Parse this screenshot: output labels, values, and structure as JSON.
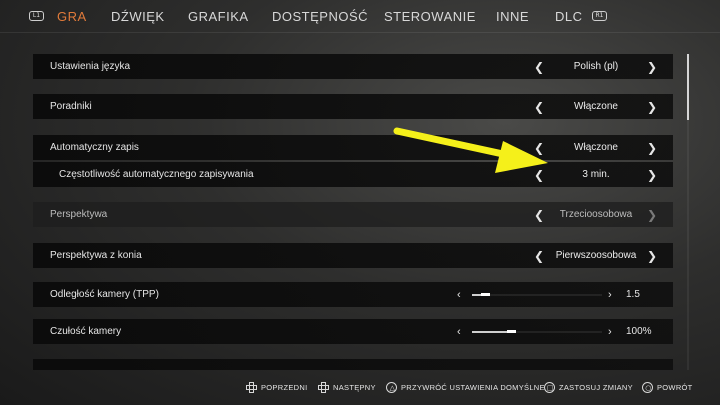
{
  "tabs": {
    "left_shoulder": "L1",
    "right_shoulder": "R1",
    "items": [
      "GRA",
      "DŹWIĘK",
      "GRAFIKA",
      "DOSTĘPNOŚĆ",
      "STEROWANIE",
      "INNE",
      "DLC"
    ]
  },
  "settings": [
    {
      "label": "Ustawienia języka",
      "value": "Polish (pl)"
    },
    {
      "label": "Poradniki",
      "value": "Włączone"
    },
    {
      "label": "Automatyczny zapis",
      "value": "Włączone"
    },
    {
      "label": "Częstotliwość automatycznego zapisywania",
      "value": "3 min."
    },
    {
      "label": "Perspektywa",
      "value": "Trzecioosobowa"
    },
    {
      "label": "Perspektywa z konia",
      "value": "Pierwszoosobowa"
    },
    {
      "label": "Odległość kamery (TPP)",
      "value": "1.5",
      "level": 0.1
    },
    {
      "label": "Czułość kamery",
      "value": "100%",
      "level": 0.3
    }
  ],
  "footer": {
    "prev": "POPRZEDNI",
    "next": "NASTĘPNY",
    "reset": "PRZYWRÓĆ USTAWIENIA DOMYŚLNE",
    "apply": "ZASTOSUJ ZMIANY",
    "back": "POWRÓT",
    "icons": {
      "prev": "dpad-left-icon",
      "next": "dpad-right-icon",
      "reset": "triangle-button-icon",
      "apply": "square-button-icon",
      "back": "circle-button-icon"
    }
  },
  "colors": {
    "active_tab": "#e07a3a",
    "annotation_arrow": "#f5f01a"
  }
}
